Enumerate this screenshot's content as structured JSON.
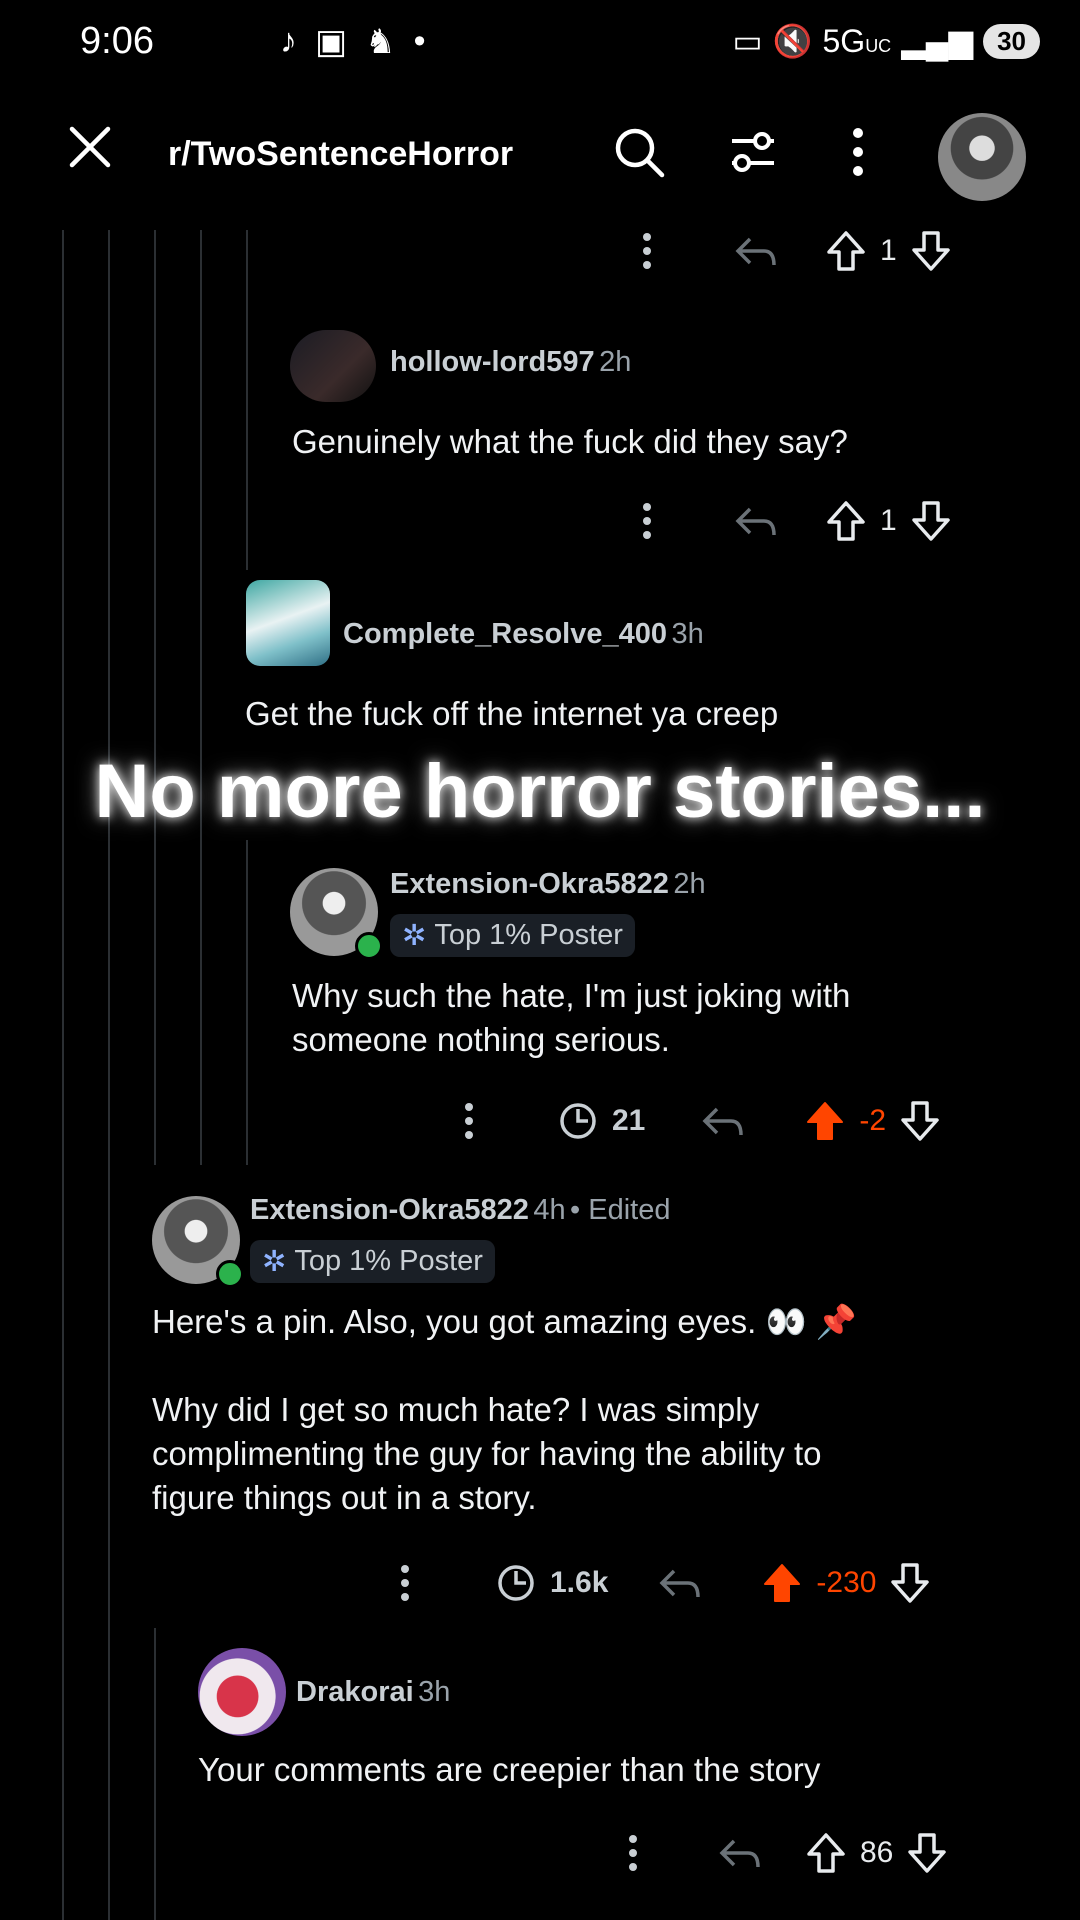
{
  "status_bar": {
    "time": "9:06",
    "network": "5G",
    "network_sub": "UC",
    "battery": "30",
    "left_icons": [
      "tiktok-icon",
      "twitch-icon",
      "snapchat-icon",
      "dot-icon"
    ]
  },
  "topbar": {
    "title": "r/TwoSentenceHorror"
  },
  "overlay": {
    "caption": "No more horror stories..."
  },
  "comments": [
    {
      "votes": "1"
    },
    {
      "user": "hollow-lord597",
      "time": "2h",
      "text": "Genuinely what the fuck did they say?",
      "votes": "1"
    },
    {
      "user": "Complete_Resolve_400",
      "time": "3h",
      "text": "Get the fuck off the internet ya creep"
    },
    {
      "user": "Extension-Okra5822",
      "time": "2h",
      "flair": "Top 1% Poster",
      "text_lines": [
        "Why such the hate, I'm just joking with",
        "someone nothing serious."
      ],
      "views": "21",
      "votes": "-2"
    },
    {
      "user": "Extension-Okra5822",
      "time": "4h",
      "edited": "• Edited",
      "flair": "Top 1% Poster",
      "text_first": "Here's a pin. Also, you got amazing eyes. 👀 📌",
      "text_lines": [
        "Why did I get so much hate? I was simply",
        "complimenting the guy for having the ability to",
        "figure things out in a story."
      ],
      "views": "1.6k",
      "votes": "-230"
    },
    {
      "user": "Drakorai",
      "time": "3h",
      "text": "Your comments are creepier than the story",
      "votes": "86"
    }
  ],
  "colors": {
    "background": "#000000",
    "downvoted": "#ff4500",
    "online": "#2bb24c"
  }
}
